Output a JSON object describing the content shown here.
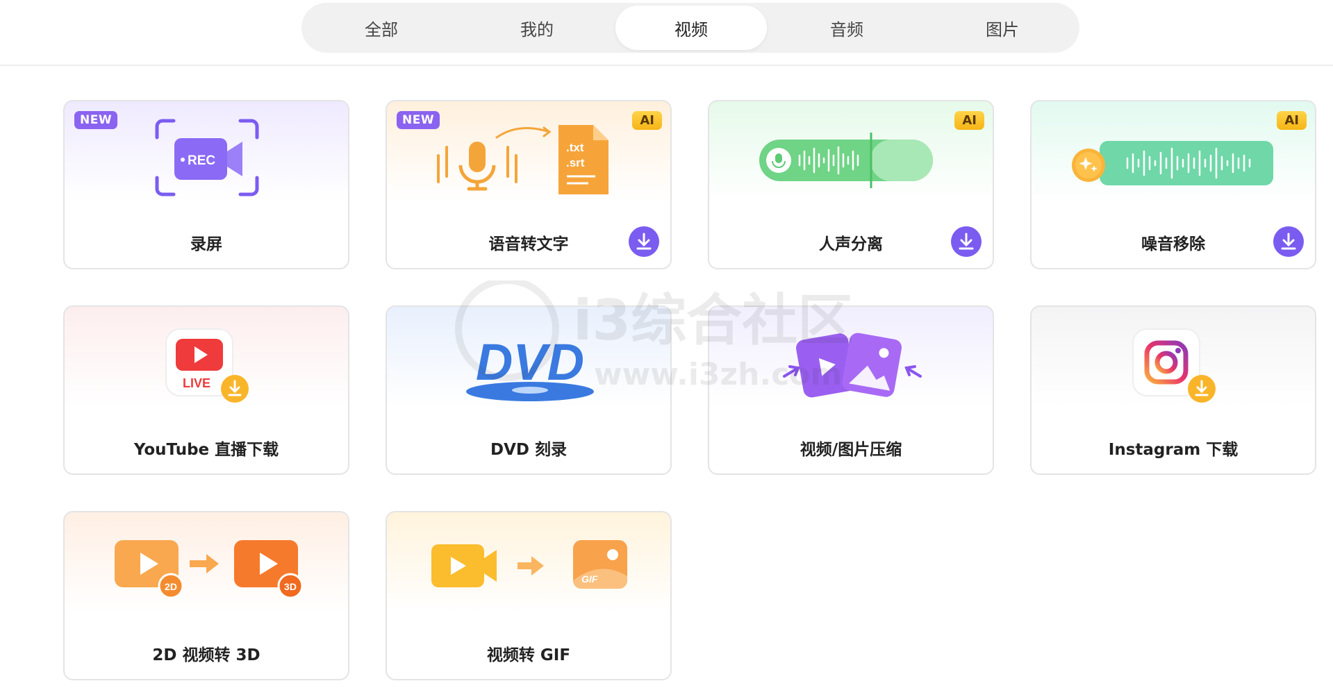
{
  "tabs": [
    {
      "id": "all",
      "label": "全部",
      "active": false
    },
    {
      "id": "mine",
      "label": "我的",
      "active": false
    },
    {
      "id": "video",
      "label": "视频",
      "active": true
    },
    {
      "id": "audio",
      "label": "音频",
      "active": false
    },
    {
      "id": "image",
      "label": "图片",
      "active": false
    }
  ],
  "tools": [
    {
      "id": "screen-record",
      "label": "录屏",
      "badge_new": "NEW",
      "badge_ai": null,
      "download": false,
      "icon": "rec-camera-icon",
      "icon_text": "REC"
    },
    {
      "id": "speech-to-text",
      "label": "语音转文字",
      "badge_new": "NEW",
      "badge_ai": "AI",
      "download": true,
      "icon": "speech-to-text-icon",
      "icon_text": [
        ".txt",
        ".srt"
      ]
    },
    {
      "id": "vocal-separation",
      "label": "人声分离",
      "badge_new": null,
      "badge_ai": "AI",
      "download": true,
      "icon": "vocal-separation-icon"
    },
    {
      "id": "noise-removal",
      "label": "噪音移除",
      "badge_new": null,
      "badge_ai": "AI",
      "download": true,
      "icon": "noise-removal-icon"
    },
    {
      "id": "youtube-live",
      "label": "YouTube 直播下载",
      "badge_new": null,
      "badge_ai": null,
      "download": false,
      "icon": "youtube-live-icon",
      "icon_text": "LIVE"
    },
    {
      "id": "dvd-burn",
      "label": "DVD 刻录",
      "badge_new": null,
      "badge_ai": null,
      "download": false,
      "icon": "dvd-icon",
      "icon_text": "DVD"
    },
    {
      "id": "compress",
      "label": "视频/图片压缩",
      "badge_new": null,
      "badge_ai": null,
      "download": false,
      "icon": "compress-icon"
    },
    {
      "id": "instagram",
      "label": "Instagram 下载",
      "badge_new": null,
      "badge_ai": null,
      "download": false,
      "icon": "instagram-icon"
    },
    {
      "id": "2d-to-3d",
      "label": "2D 视频转 3D",
      "badge_new": null,
      "badge_ai": null,
      "download": false,
      "icon": "2d-to-3d-icon",
      "icon_text": [
        "2D",
        "3D"
      ]
    },
    {
      "id": "video-to-gif",
      "label": "视频转 GIF",
      "badge_new": null,
      "badge_ai": null,
      "download": false,
      "icon": "video-to-gif-icon",
      "icon_text": "GIF"
    }
  ],
  "watermark": {
    "line1": "i3综合社区",
    "line2": "www.i3zh.com"
  },
  "colors": {
    "accent": "#7b5cf0",
    "ai_badge": "#f6b515",
    "new_badge": "#8a63f0",
    "orange": "#f6a43a",
    "green": "#5ecb76"
  }
}
